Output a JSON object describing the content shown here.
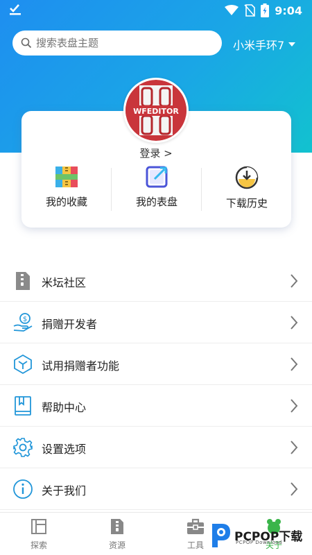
{
  "status_bar": {
    "time": "9:04"
  },
  "search": {
    "placeholder": "搜索表盘主题"
  },
  "device": {
    "selected": "小米手环7"
  },
  "profile": {
    "logo_text": "WFEDITOR",
    "login_label": "登录 >"
  },
  "quick_actions": [
    {
      "label": "我的收藏",
      "icon": "archive-icon"
    },
    {
      "label": "我的表盘",
      "icon": "edit-dial-icon"
    },
    {
      "label": "下载历史",
      "icon": "download-history-icon"
    }
  ],
  "menu": [
    {
      "label": "米坛社区",
      "icon": "community-icon"
    },
    {
      "label": "捐赠开发者",
      "icon": "donate-icon"
    },
    {
      "label": "试用捐赠者功能",
      "icon": "cube-icon"
    },
    {
      "label": "帮助中心",
      "icon": "book-icon"
    },
    {
      "label": "设置选项",
      "icon": "gear-icon"
    },
    {
      "label": "关于我们",
      "icon": "info-icon"
    }
  ],
  "bottom_nav": [
    {
      "label": "探索",
      "icon": "explore-icon"
    },
    {
      "label": "资源",
      "icon": "resource-icon"
    },
    {
      "label": "工具",
      "icon": "toolbox-icon"
    },
    {
      "label": "关于",
      "icon": "about-icon",
      "active": true
    }
  ],
  "watermark": {
    "brand": "PCPOP下载",
    "sub": "PCPOP Download"
  },
  "colors": {
    "header_start": "#1e8ef0",
    "header_end": "#12c2cf",
    "icon_blue": "#2196d9",
    "active_green": "#3ab54a"
  }
}
